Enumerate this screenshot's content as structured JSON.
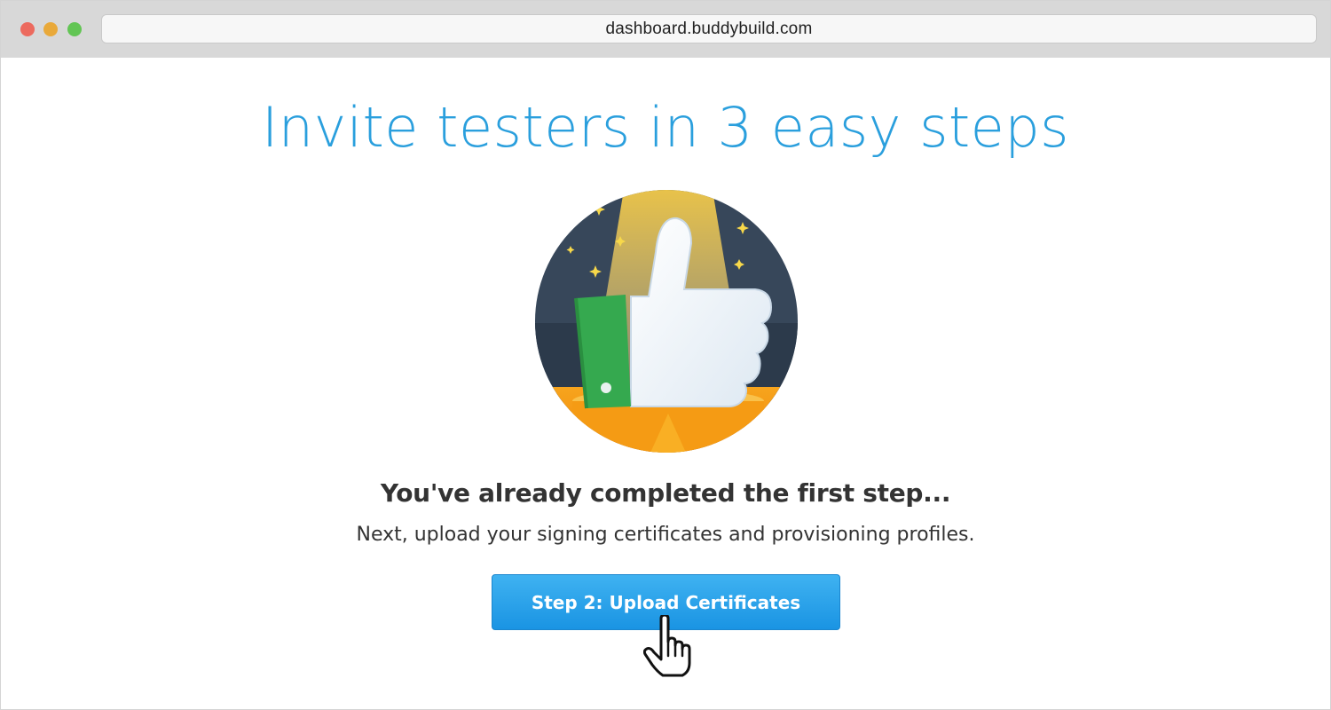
{
  "browser": {
    "url": "dashboard.buddybuild.com"
  },
  "main": {
    "headline": "Invite testers in 3 easy steps",
    "subhead": "You've already completed the first step...",
    "description": "Next, upload your signing certificates and provisioning profiles.",
    "cta_label": "Step 2: Upload Certificates"
  },
  "colors": {
    "accent": "#2a9fdd",
    "button_top": "#3fb2f1",
    "button_bottom": "#1a94e3",
    "text": "#333333"
  },
  "icons": {
    "illustration": "thumbs-up-illustration",
    "cursor": "hand-pointer-icon"
  }
}
